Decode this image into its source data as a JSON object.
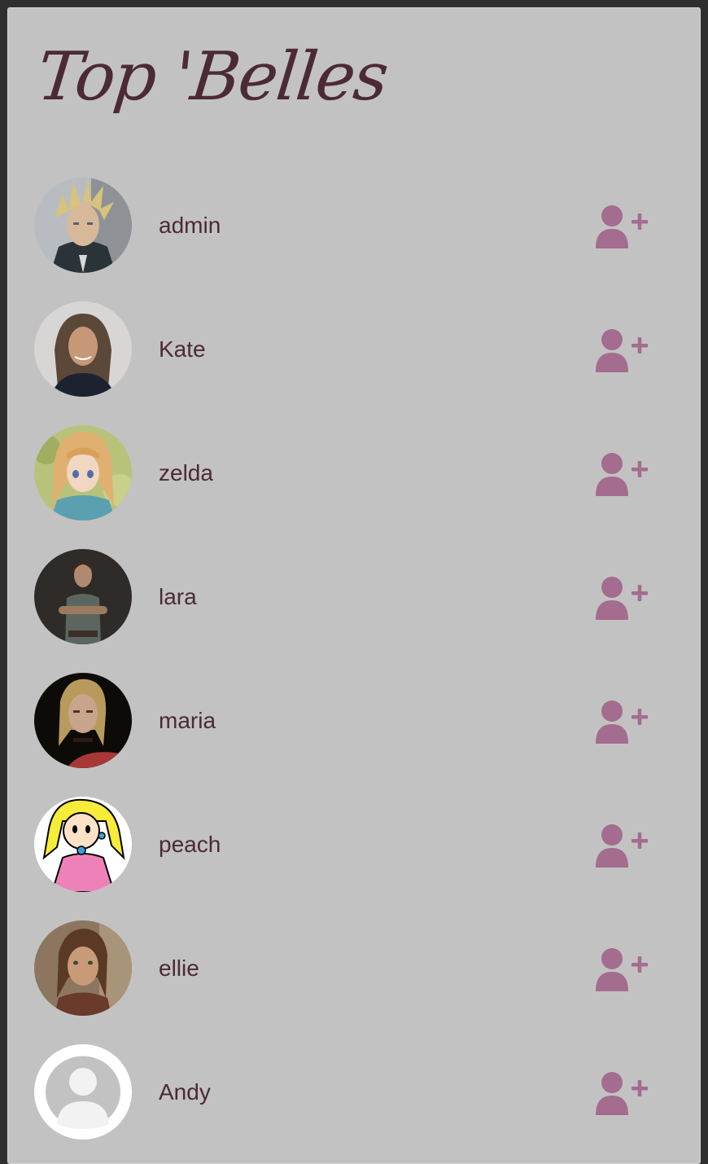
{
  "header": {
    "title": "Top 'Belles"
  },
  "colors": {
    "panel_bg": "#c2c2c2",
    "title_color": "#4b2a36",
    "text_color": "#4b2a36",
    "add_icon_color": "#a46c8e",
    "page_bg": "#2f2f2f"
  },
  "users": [
    {
      "name": "admin",
      "avatar": "spiky-blond-hair-portrait",
      "action_icon": "user-plus-icon"
    },
    {
      "name": "Kate",
      "avatar": "woman-photo-portrait",
      "action_icon": "user-plus-icon"
    },
    {
      "name": "zelda",
      "avatar": "elf-princess-portrait",
      "action_icon": "user-plus-icon"
    },
    {
      "name": "lara",
      "avatar": "adventurer-woman-portrait",
      "action_icon": "user-plus-icon"
    },
    {
      "name": "maria",
      "avatar": "blonde-woman-dark-portrait",
      "action_icon": "user-plus-icon"
    },
    {
      "name": "peach",
      "avatar": "cartoon-princess-portrait",
      "action_icon": "user-plus-icon"
    },
    {
      "name": "ellie",
      "avatar": "girl-freckles-portrait",
      "action_icon": "user-plus-icon"
    },
    {
      "name": "Andy",
      "avatar": "default-user-avatar",
      "action_icon": "user-plus-icon"
    }
  ]
}
